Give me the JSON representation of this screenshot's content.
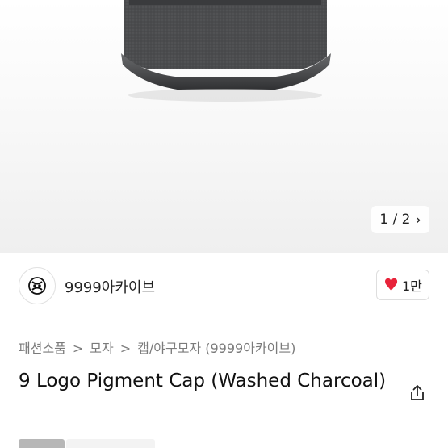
{
  "gallery": {
    "pager": "1 / 2",
    "next_icon": "chevron-right-icon"
  },
  "store": {
    "name": "9999아카이브",
    "logo_icon": "brand-logo-icon"
  },
  "like": {
    "count": "1만",
    "icon": "heart-icon",
    "color": "#e8233a"
  },
  "breadcrumb": {
    "items": [
      "패션소품",
      "모자",
      "캡/야구모자 (9999아카이브)"
    ],
    "separator": ">"
  },
  "product": {
    "title": "9 Logo Pigment Cap (Washed Charcoal)",
    "share_icon": "share-icon"
  }
}
